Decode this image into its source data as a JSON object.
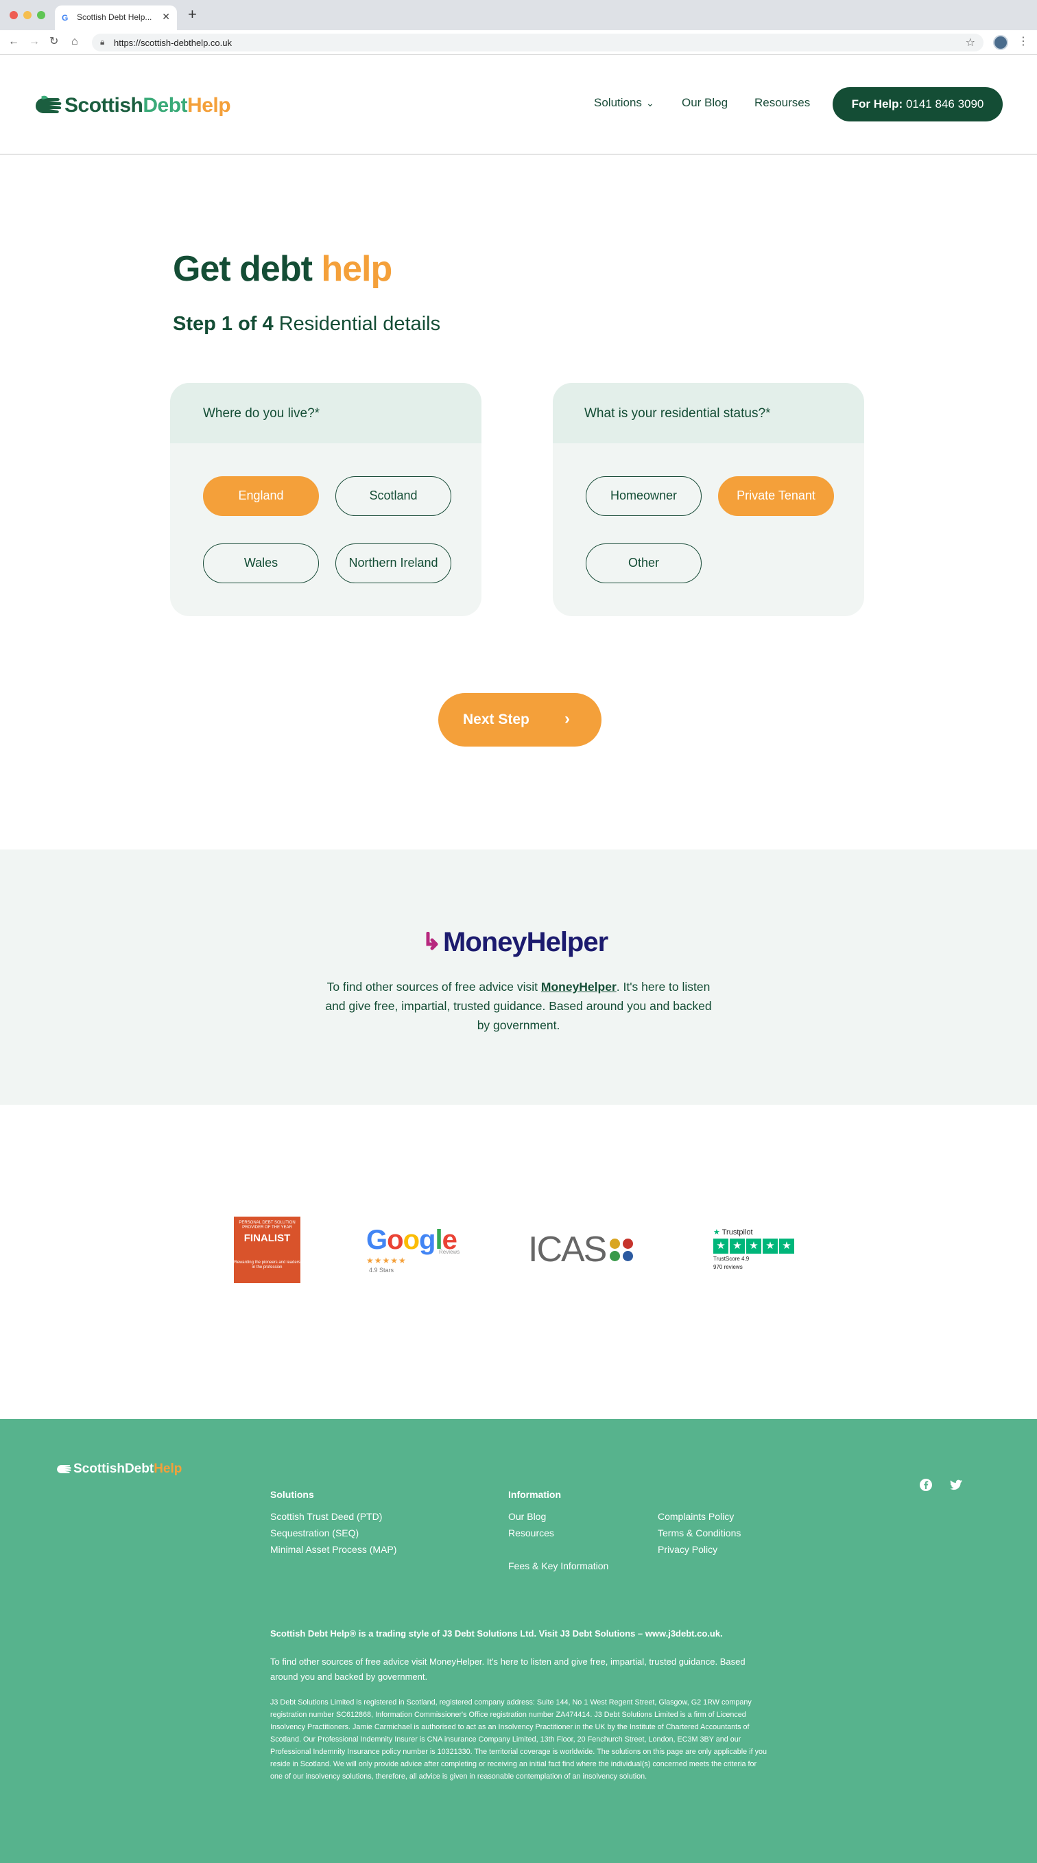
{
  "browser": {
    "tab_title": "Scottish Debt Help...",
    "url": "https://scottish-debthelp.co.uk"
  },
  "header": {
    "logo_a": "Scottish",
    "logo_b": "Debt",
    "logo_c": "Help",
    "nav": [
      {
        "label": "Solutions"
      },
      {
        "label": "Our Blog"
      },
      {
        "label": "Resourses"
      }
    ],
    "help_label": "For Help:",
    "help_phone": "0141 846 3090"
  },
  "page": {
    "title_a": "Get debt",
    "title_b": "help",
    "step_bold": "Step 1 of 4",
    "step_text": "Residential details"
  },
  "form": {
    "where": {
      "question": "Where do you live?*",
      "options": [
        "England",
        "Scotland",
        "Wales",
        "Northern Ireland"
      ],
      "selected": "England"
    },
    "status": {
      "question": "What is your residential status?*",
      "options": [
        "Homeowner",
        "Private Tenant",
        "Other"
      ],
      "selected": "Private Tenant"
    },
    "next_label": "Next Step",
    "next_arrow": "›"
  },
  "moneyhelper": {
    "logo": "MoneyHelper",
    "text_before": "To find other sources of free advice visit",
    "link": "MoneyHelper",
    "text_after": ". It's here to listen and give free, impartial, trusted guidance. Based around you and backed by government."
  },
  "badges": {
    "finalist_small": "PERSONAL DEBT SOLUTION PROVIDER OF THE YEAR",
    "finalist_big": "FINALIST",
    "finalist_small2": "Rewarding the pioneers and leaders in the profession",
    "google_word": [
      "G",
      "o",
      "o",
      "g",
      "l",
      "e"
    ],
    "google_stars": "★★★★★",
    "google_reviews": "Reviews",
    "google_rating": "4.9 Stars",
    "icas": "ICAS",
    "trustpilot": "Trustpilot",
    "trustscore": "TrustScore 4.9",
    "tp_reviews": "970 reviews"
  },
  "footer": {
    "logo_a": "ScottishDebt",
    "logo_b": "Help",
    "solutions_heading": "Solutions",
    "solutions": [
      "Scottish Trust Deed (PTD)",
      "Sequestration (SEQ)",
      "Minimal Asset Process (MAP)"
    ],
    "information_heading": "Information",
    "information_col1": [
      "Our Blog",
      "Resources"
    ],
    "information_extra": "Fees & Key Information",
    "information_col2": [
      "Complaints Policy",
      "Terms & Conditions",
      "Privacy Policy"
    ],
    "trading": "Scottish Debt Help® is a trading style of J3 Debt Solutions Ltd. Visit J3 Debt Solutions – www.j3debt.co.uk.",
    "advice": "To find other sources of free advice visit MoneyHelper. It's here to listen and give free, impartial, trusted guidance. Based around you and backed by government.",
    "legal": "J3 Debt Solutions Limited is registered in Scotland, registered company address: Suite 144, No 1 West Regent Street, Glasgow, G2 1RW company registration number SC612868, Information Commissioner's Office registration number ZA474414. J3 Debt Solutions Limited is a firm of Licenced Insolvency Practitioners. Jamie Carmichael is authorised to act as an Insolvency Practitioner in the UK by the Institute of Chartered Accountants of Scotland. Our Professional Indemnity Insurer is CNA insurance Company Limited, 13th Floor, 20 Fenchurch Street, London, EC3M 3BY and our Professional Indemnity Insurance policy number is 10321330. The territorial coverage is worldwide. The solutions on this page are only applicable if you reside in Scotland. We will only provide advice after completing or receiving an initial fact find where the individual(s) concerned meets the criteria for one of our insolvency solutions, therefore, all advice is given in reasonable contemplation of an insolvency solution."
  },
  "colors": {
    "brand_dark": "#144d35",
    "brand_orange": "#f4a03a",
    "footer_green": "#57b38d"
  }
}
